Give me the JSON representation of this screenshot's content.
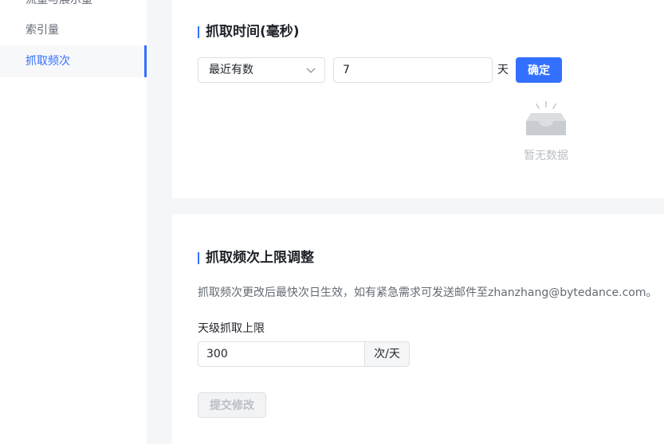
{
  "sidebar": {
    "items": [
      {
        "label": "流量与展示量"
      },
      {
        "label": "索引量"
      },
      {
        "label": "抓取频次",
        "active": true
      }
    ]
  },
  "fetch_time": {
    "title": "抓取时间(毫秒)",
    "select_value": "最近有数",
    "days_value": "7",
    "days_unit": "天",
    "confirm_label": "确定",
    "empty_text": "暂无数据"
  },
  "fetch_limit": {
    "title": "抓取频次上限调整",
    "description": "抓取频次更改后最快次日生效，如有紧急需求可发送邮件至zhanzhang@bytedance.com。",
    "field_label": "天级抓取上限",
    "limit_value": "300",
    "limit_unit": "次/天",
    "submit_label": "提交修改"
  },
  "colors": {
    "accent": "#3370ff",
    "muted": "#bbbfc4"
  }
}
